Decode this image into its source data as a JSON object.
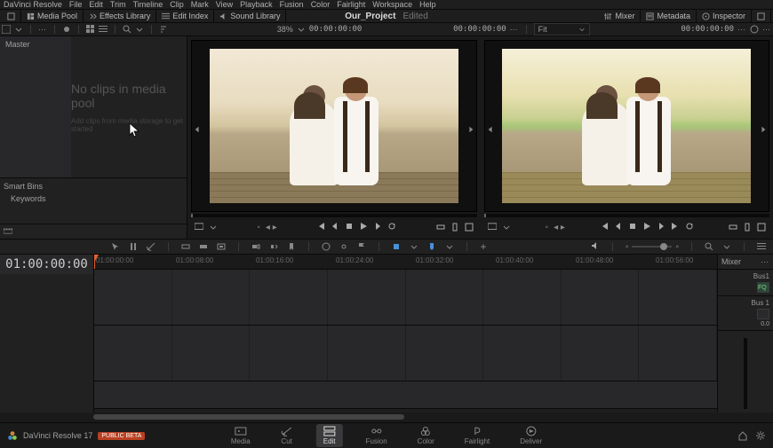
{
  "menu": {
    "items": [
      "DaVinci Resolve",
      "File",
      "Edit",
      "Trim",
      "Timeline",
      "Clip",
      "Mark",
      "View",
      "Playback",
      "Fusion",
      "Color",
      "Fairlight",
      "Workspace",
      "Help"
    ]
  },
  "toolbar1": {
    "left": [
      {
        "label": "Media Pool",
        "icon": "mediapool"
      },
      {
        "label": "Effects Library",
        "icon": "fx"
      },
      {
        "label": "Edit Index",
        "icon": "list"
      },
      {
        "label": "Sound Library",
        "icon": "sound"
      }
    ],
    "right": [
      {
        "label": "Mixer",
        "icon": "sliders"
      },
      {
        "label": "Metadata",
        "icon": "meta"
      },
      {
        "label": "Inspector",
        "icon": "inspect"
      }
    ]
  },
  "project": {
    "name": "Our_Project",
    "status": "Edited"
  },
  "viewer_opts": {
    "zoom_pct": "38%",
    "left_tc": "00:00:00:00",
    "src_tc": "00:00:00:00",
    "fit": "Fit",
    "rec_tc": "00:00:00:00"
  },
  "mediapool": {
    "root": "Master",
    "empty": "No clips in media pool",
    "empty_sub": "Add clips from media storage to get started",
    "smart": "Smart Bins",
    "keywords": "Keywords"
  },
  "timeline": {
    "tc": "01:00:00:00",
    "ruler": [
      "01:00:00:00",
      "01:00:08:00",
      "01:00:16:00",
      "01:00:24:00",
      "01:00:32:00",
      "01:00:40:00",
      "01:00:48:00",
      "01:00:56:00"
    ]
  },
  "mixer": {
    "title": "Mixer",
    "bus1": "Bus1",
    "bus1_lbl": "FQ",
    "bus2": "Bus 1",
    "val": "0.0"
  },
  "footer": {
    "app": "DaVinci Resolve 17",
    "badge": "PUBLIC BETA"
  },
  "pages": [
    {
      "label": "Media"
    },
    {
      "label": "Cut"
    },
    {
      "label": "Edit",
      "active": true
    },
    {
      "label": "Fusion"
    },
    {
      "label": "Color"
    },
    {
      "label": "Fairlight"
    },
    {
      "label": "Deliver"
    }
  ]
}
